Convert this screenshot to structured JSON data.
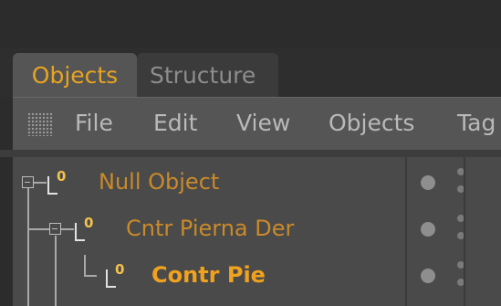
{
  "tabs": [
    {
      "label": "Objects",
      "active": true
    },
    {
      "label": "Structure",
      "active": false
    }
  ],
  "menubar": {
    "items": [
      "File",
      "Edit",
      "View",
      "Objects",
      "Tag"
    ]
  },
  "tree": {
    "rows": [
      {
        "label": "Null Object",
        "icon": "null-object-icon",
        "color": "#c98a2a",
        "level": 0
      },
      {
        "label": "Cntr Pierna Der",
        "icon": "null-object-icon",
        "color": "#c98a2a",
        "level": 1
      },
      {
        "label": "Contr Pie",
        "icon": "null-object-icon",
        "color": "#f0a21e",
        "level": 2
      }
    ],
    "null_glyph": "0"
  },
  "colors": {
    "accent_orange": "#e8a321",
    "panel_bg": "#4a4a4a",
    "menubar_bg": "#555555"
  }
}
